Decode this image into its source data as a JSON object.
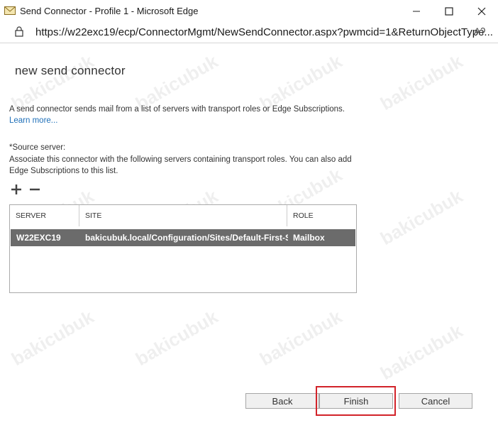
{
  "window": {
    "title": "Send Connector - Profile 1 - Microsoft Edge",
    "url_main": "https://w22exc19/ecp/ConnectorMgmt/NewSendConnector.aspx?pwmcid=1&ReturnObjectType...",
    "read_aloud_glyph": "Aʔ"
  },
  "page": {
    "title": "new send connector",
    "intro": "A send connector sends mail from a list of servers with transport roles or Edge Subscriptions.",
    "learn_more": "Learn more...",
    "source_label": "*Source server:",
    "source_desc": "Associate this connector with the following servers containing transport roles. You can also add Edge Subscriptions to this list.",
    "table": {
      "headers": [
        "SERVER",
        "SITE",
        "ROLE"
      ],
      "rows": [
        {
          "server": "W22EXC19",
          "site": "bakicubuk.local/Configuration/Sites/Default-First-S...",
          "role": "Mailbox"
        }
      ]
    }
  },
  "buttons": {
    "back": "Back",
    "finish": "Finish",
    "cancel": "Cancel"
  },
  "watermark": "bakicubuk",
  "colors": {
    "selected_row": "#6b6b6b",
    "link": "#1e6fb8",
    "highlight": "#d2232a"
  }
}
